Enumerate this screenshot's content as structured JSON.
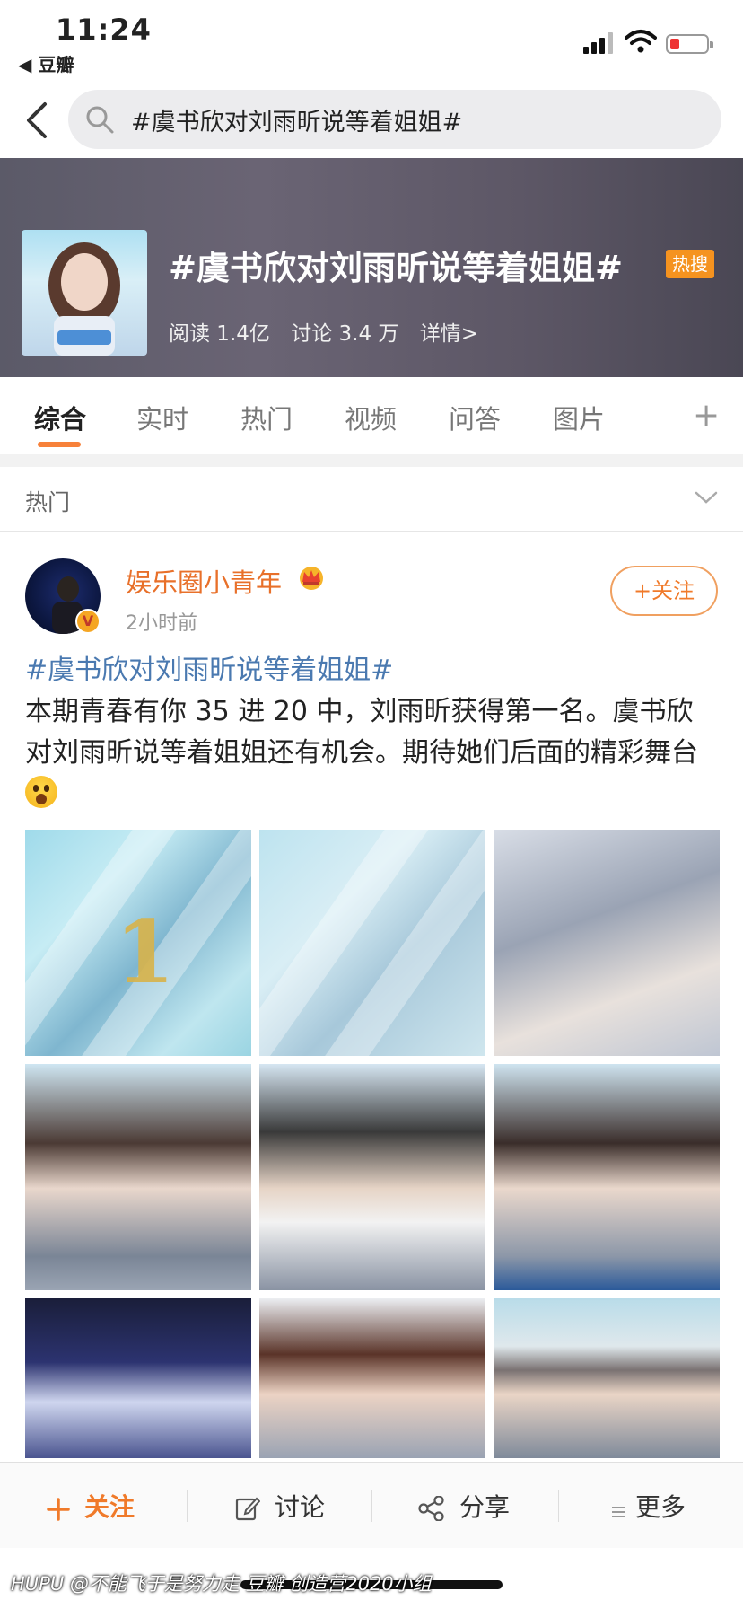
{
  "status_bar": {
    "time": "11:24",
    "back_app": "◀ 豆瓣"
  },
  "search": {
    "query": "#虞书欣对刘雨昕说等着姐姐#"
  },
  "topic": {
    "title": "#虞书欣对刘雨昕说等着姐姐#",
    "badge": "热搜",
    "reads": "阅读 1.4亿",
    "discussions": "讨论 3.4 万",
    "details": "详情>"
  },
  "tabs": [
    "综合",
    "实时",
    "热门",
    "视频",
    "问答",
    "图片"
  ],
  "section": {
    "title": "热门"
  },
  "post": {
    "author": "娱乐圈小青年",
    "time": "2小时前",
    "follow": "+关注",
    "hashtag": "#虞书欣对刘雨昕说等着姐姐#",
    "body": "本期青春有你 35 进 20 中，刘雨昕获得第一名。虞书欣对刘雨昕说等着姐姐还有机会。期待她们后面的精彩舞台",
    "image_number": "1"
  },
  "bottom_bar": {
    "follow": "关注",
    "discuss": "讨论",
    "share": "分享",
    "more": "更多"
  },
  "watermark": "HUPU @不能飞于是努力走    豆瓣 创造营2020小组",
  "colors": {
    "accent": "#f07a2a",
    "link": "#4a79b0",
    "hot_badge": "#f5931f"
  }
}
